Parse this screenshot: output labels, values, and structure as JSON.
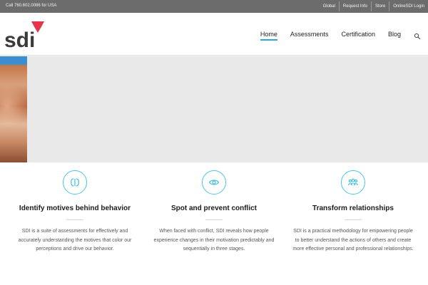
{
  "topbar": {
    "phone": "Call 760.602.0086 for USA",
    "links": [
      "Global",
      "Request Info",
      "Store",
      "OnlineSDI Login"
    ]
  },
  "header": {
    "logo_text": "sdi",
    "nav": [
      "Home",
      "Assessments",
      "Certification",
      "Blog"
    ],
    "active_nav": "Home",
    "accent_color": "#2aa6d8"
  },
  "features": [
    {
      "icon": "brain-icon",
      "title": "Identify motives behind behavior",
      "text": "SDI is a suite of assessments for effectively and accurately understanding the motives that color our perceptions and drive our behavior."
    },
    {
      "icon": "eye-icon",
      "title": "Spot and prevent conflict",
      "text": "When faced with conflict, SDI reveals how people experience changes in their motivation predictably and sequentially in three stages."
    },
    {
      "icon": "people-icon",
      "title": "Transform relationships",
      "text": "SDI is a practical methodology for empowering people to better understand the actions of others and create more effective personal and professional relationships."
    }
  ]
}
